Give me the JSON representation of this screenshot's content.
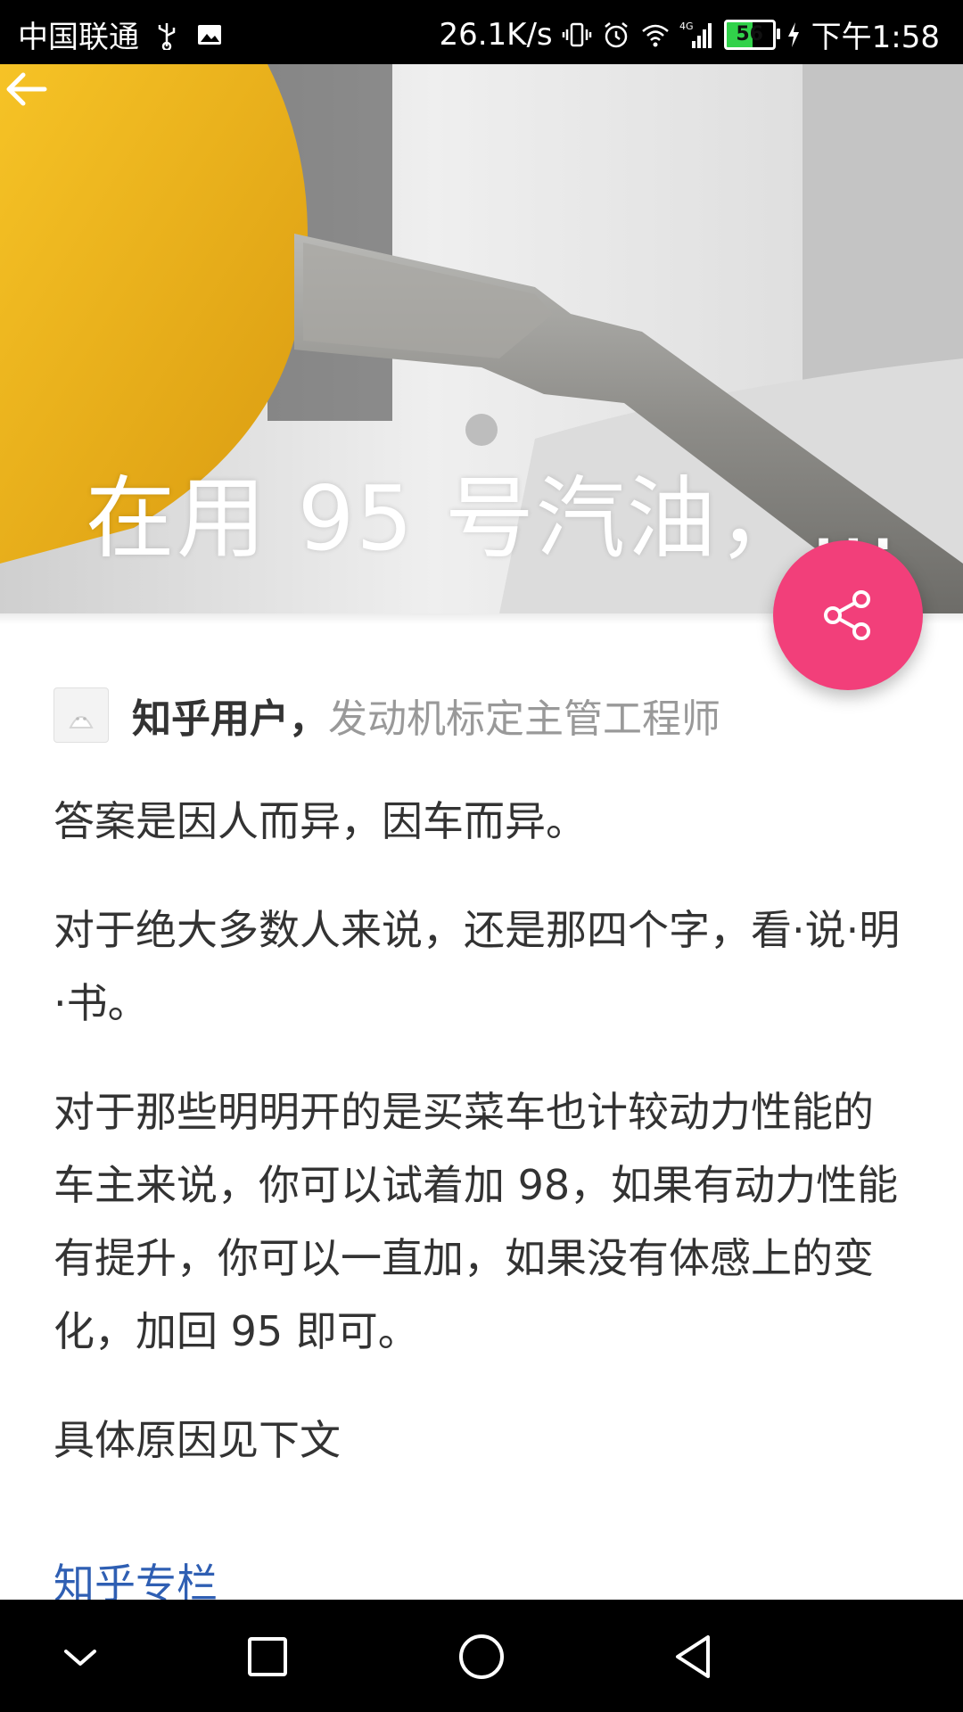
{
  "status_bar": {
    "carrier": "中国联通",
    "network_speed": "26.1K/s",
    "battery_level": "56",
    "time": "下午1:58",
    "icons": [
      "usb-icon",
      "image-icon",
      "vibrate-icon",
      "alarm-icon",
      "wifi-icon",
      "4g-signal-icon",
      "battery-icon",
      "charging-icon"
    ]
  },
  "header": {
    "title": "在用 95 号汽油，…",
    "back_icon": "back-arrow-icon",
    "share_icon": "share-icon",
    "accent_color": "#f23f7a"
  },
  "author": {
    "name": "知乎用户，",
    "bio": "发动机标定主管工程师"
  },
  "article": {
    "paragraphs": [
      "答案是因人而异，因车而异。",
      "对于绝大多数人来说，还是那四个字，看·说·明·书。",
      "对于那些明明开的是买菜车也计较动力性能的车主来说，你可以试着加 98，如果有动力性能有提升，你可以一直加，如果没有体感上的变化，加回 95 即可。",
      "具体原因见下文"
    ],
    "link_text": "知乎专栏",
    "link_color": "#2f5fb3"
  },
  "nav_bar": {
    "icons": [
      "collapse-icon",
      "recents-icon",
      "home-icon",
      "back-icon"
    ]
  }
}
